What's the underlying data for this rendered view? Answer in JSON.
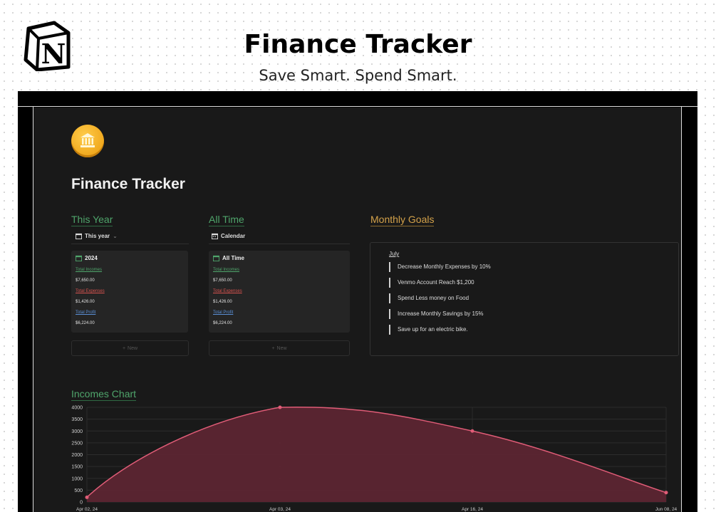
{
  "header": {
    "title": "Finance Tracker",
    "subtitle": "Save Smart. Spend Smart."
  },
  "page": {
    "title": "Finance Tracker"
  },
  "sections": {
    "this_year": {
      "title": "This Year",
      "view_label": "This year",
      "card": {
        "heading": "2024",
        "income_label": "Total Incomes",
        "income_value": "$7,650.00",
        "expense_label": "Total Expenses",
        "expense_value": "$1,426.00",
        "profit_label": "Total Profit",
        "profit_value": "$6,224.00"
      },
      "new_label": "New"
    },
    "all_time": {
      "title": "All Time",
      "view_label": "Calendar",
      "card": {
        "heading": "All Time",
        "income_label": "Total Incomes",
        "income_value": "$7,650.00",
        "expense_label": "Total Expenses",
        "expense_value": "$1,426.00",
        "profit_label": "Total Profit",
        "profit_value": "$6,224.00"
      },
      "new_label": "New"
    },
    "monthly_goals": {
      "title": "Monthly Goals",
      "month": "July",
      "items": [
        "Decrease Monthly Expenses by 10%",
        "Venmo Account Reach $1,200",
        "Spend Less money on Food",
        "Increase Monthly Savings by 15%",
        "Save up for an electric bike."
      ]
    },
    "incomes_chart": {
      "title": "Incomes Chart"
    }
  },
  "colors": {
    "accent_green": "#4fa56b",
    "accent_orange": "#d4a24a",
    "chart_line": "#e05c77",
    "chart_fill": "#5c2532"
  },
  "chart_data": {
    "type": "area",
    "x": [
      "Apr 02, 24",
      "Apr 03, 24",
      "Apr 16, 24",
      "Jun 08, 24"
    ],
    "series": [
      {
        "values": [
          200,
          4000,
          3000,
          400
        ]
      }
    ],
    "yticks": [
      0,
      500,
      1000,
      1500,
      2000,
      2500,
      3000,
      3500,
      4000
    ],
    "ylim": [
      0,
      4000
    ],
    "grid": true
  }
}
